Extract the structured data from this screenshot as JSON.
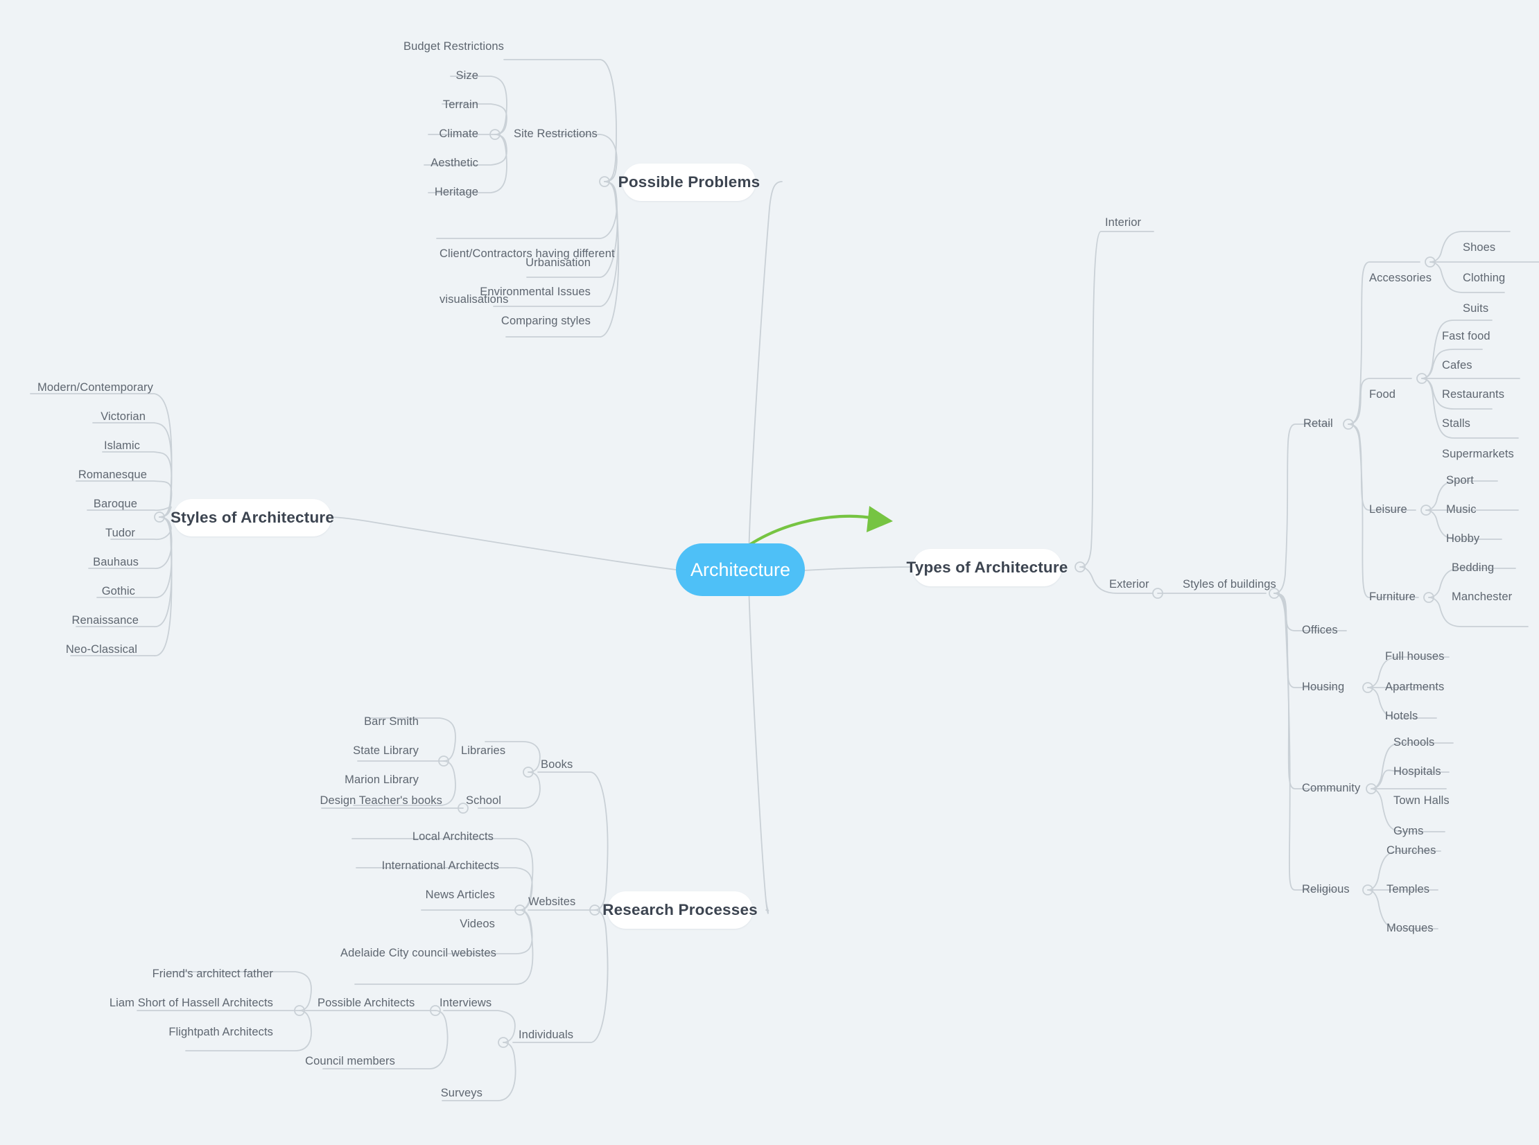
{
  "root": {
    "label": "Architecture",
    "color": "#4ec0f7"
  },
  "accent_arrow_color": "#76c442",
  "edge_color": "#c9d0d6",
  "background_color": "#eff3f6",
  "main_branches": [
    {
      "id": "possible-problems",
      "label": "Possible Problems"
    },
    {
      "id": "styles-of-architecture",
      "label": "Styles of Architecture"
    },
    {
      "id": "types-of-architecture",
      "label": "Types of Architecture"
    },
    {
      "id": "research-processes",
      "label": "Research Processes"
    }
  ],
  "possible_problems": {
    "label": "Possible Problems",
    "children": [
      {
        "label": "Budget Restrictions"
      },
      {
        "label": "Site Restrictions",
        "children": [
          {
            "label": "Size"
          },
          {
            "label": "Terrain"
          },
          {
            "label": "Climate"
          },
          {
            "label": "Aesthetic"
          },
          {
            "label": "Heritage"
          }
        ]
      },
      {
        "label": "Client/Contractors having different\nvisualisations"
      },
      {
        "label": "Urbanisation"
      },
      {
        "label": "Environmental Issues"
      },
      {
        "label": "Comparing styles"
      }
    ]
  },
  "styles_of_architecture": {
    "label": "Styles of Architecture",
    "children": [
      {
        "label": "Modern/Contemporary"
      },
      {
        "label": "Victorian"
      },
      {
        "label": "Islamic"
      },
      {
        "label": "Romanesque"
      },
      {
        "label": "Baroque"
      },
      {
        "label": "Tudor"
      },
      {
        "label": "Bauhaus"
      },
      {
        "label": "Gothic"
      },
      {
        "label": "Renaissance"
      },
      {
        "label": "Neo-Classical"
      }
    ]
  },
  "types_of_architecture": {
    "label": "Types of Architecture",
    "children": [
      {
        "label": "Interior"
      },
      {
        "label": "Exterior",
        "children": [
          {
            "label": "Styles of buildings",
            "children": [
              {
                "label": "Retail",
                "children": [
                  {
                    "label": "Accessories",
                    "children": [
                      {
                        "label": "Shoes"
                      },
                      {
                        "label": "Clothing"
                      },
                      {
                        "label": "Suits"
                      }
                    ]
                  },
                  {
                    "label": "Food",
                    "children": [
                      {
                        "label": "Fast food"
                      },
                      {
                        "label": "Cafes"
                      },
                      {
                        "label": "Restaurants"
                      },
                      {
                        "label": "Stalls"
                      },
                      {
                        "label": "Supermarkets"
                      }
                    ]
                  },
                  {
                    "label": "Leisure",
                    "children": [
                      {
                        "label": "Sport"
                      },
                      {
                        "label": "Music"
                      },
                      {
                        "label": "Hobby"
                      }
                    ]
                  },
                  {
                    "label": "Furniture",
                    "children": [
                      {
                        "label": "Bedding"
                      },
                      {
                        "label": "Manchester"
                      }
                    ]
                  }
                ]
              },
              {
                "label": "Offices"
              },
              {
                "label": "Housing",
                "children": [
                  {
                    "label": "Full houses"
                  },
                  {
                    "label": "Apartments"
                  },
                  {
                    "label": "Hotels"
                  }
                ]
              },
              {
                "label": "Community",
                "children": [
                  {
                    "label": "Schools"
                  },
                  {
                    "label": "Hospitals"
                  },
                  {
                    "label": "Town Halls"
                  },
                  {
                    "label": "Gyms"
                  }
                ]
              },
              {
                "label": "Religious",
                "children": [
                  {
                    "label": "Churches"
                  },
                  {
                    "label": "Temples"
                  },
                  {
                    "label": "Mosques"
                  }
                ]
              }
            ]
          }
        ]
      }
    ]
  },
  "research_processes": {
    "label": "Research Processes",
    "children": [
      {
        "label": "Books",
        "children": [
          {
            "label": "Libraries",
            "children": [
              {
                "label": "Barr Smith"
              },
              {
                "label": "State Library"
              },
              {
                "label": "Marion Library"
              }
            ]
          },
          {
            "label": "School",
            "children": [
              {
                "label": "Design Teacher's books"
              }
            ]
          }
        ]
      },
      {
        "label": "Websites",
        "children": [
          {
            "label": "Local Architects"
          },
          {
            "label": "International Architects"
          },
          {
            "label": "News Articles"
          },
          {
            "label": "Videos"
          },
          {
            "label": "Adelaide City council webistes"
          }
        ]
      },
      {
        "label": "Individuals",
        "children": [
          {
            "label": "Interviews",
            "children": [
              {
                "label": "Possible Architects",
                "children": [
                  {
                    "label": "Friend's architect father"
                  },
                  {
                    "label": "Liam Short of Hassell Architects"
                  },
                  {
                    "label": "Flightpath Architects"
                  }
                ]
              },
              {
                "label": "Council members"
              }
            ]
          },
          {
            "label": "Surveys"
          }
        ]
      }
    ]
  },
  "labels": {
    "budget_restrictions": "Budget Restrictions",
    "site_restrictions": "Site Restrictions",
    "size": "Size",
    "terrain": "Terrain",
    "climate": "Climate",
    "aesthetic": "Aesthetic",
    "heritage": "Heritage",
    "client_contractors": "Client/Contractors having different",
    "client_contractors_2": "visualisations",
    "urbanisation": "Urbanisation",
    "environmental_issues": "Environmental Issues",
    "comparing_styles": "Comparing styles",
    "modern_contemporary": "Modern/Contemporary",
    "victorian": "Victorian",
    "islamic": "Islamic",
    "romanesque": "Romanesque",
    "baroque": "Baroque",
    "tudor": "Tudor",
    "bauhaus": "Bauhaus",
    "gothic": "Gothic",
    "renaissance": "Renaissance",
    "neo_classical": "Neo-Classical",
    "interior": "Interior",
    "exterior": "Exterior",
    "styles_of_buildings": "Styles of buildings",
    "retail": "Retail",
    "accessories": "Accessories",
    "shoes": "Shoes",
    "clothing": "Clothing",
    "suits": "Suits",
    "food": "Food",
    "fast_food": "Fast food",
    "cafes": "Cafes",
    "restaurants": "Restaurants",
    "stalls": "Stalls",
    "supermarkets": "Supermarkets",
    "leisure": "Leisure",
    "sport": "Sport",
    "music": "Music",
    "hobby": "Hobby",
    "furniture": "Furniture",
    "bedding": "Bedding",
    "manchester": "Manchester",
    "offices": "Offices",
    "housing": "Housing",
    "full_houses": "Full houses",
    "apartments": "Apartments",
    "hotels": "Hotels",
    "community": "Community",
    "schools": "Schools",
    "hospitals": "Hospitals",
    "town_halls": "Town Halls",
    "gyms": "Gyms",
    "religious": "Religious",
    "churches": "Churches",
    "temples": "Temples",
    "mosques": "Mosques",
    "books": "Books",
    "libraries": "Libraries",
    "barr_smith": "Barr Smith",
    "state_library": "State Library",
    "marion_library": "Marion Library",
    "school": "School",
    "design_teachers_books": "Design Teacher's books",
    "websites": "Websites",
    "local_architects": "Local Architects",
    "international_architects": "International Architects",
    "news_articles": "News Articles",
    "videos": "Videos",
    "adelaide_city_council": "Adelaide City council webistes",
    "individuals": "Individuals",
    "interviews": "Interviews",
    "possible_architects": "Possible Architects",
    "friends_architect_father": "Friend's architect father",
    "liam_short": "Liam Short of Hassell Architects",
    "flightpath_architects": "Flightpath Architects",
    "council_members": "Council members",
    "surveys": "Surveys"
  }
}
